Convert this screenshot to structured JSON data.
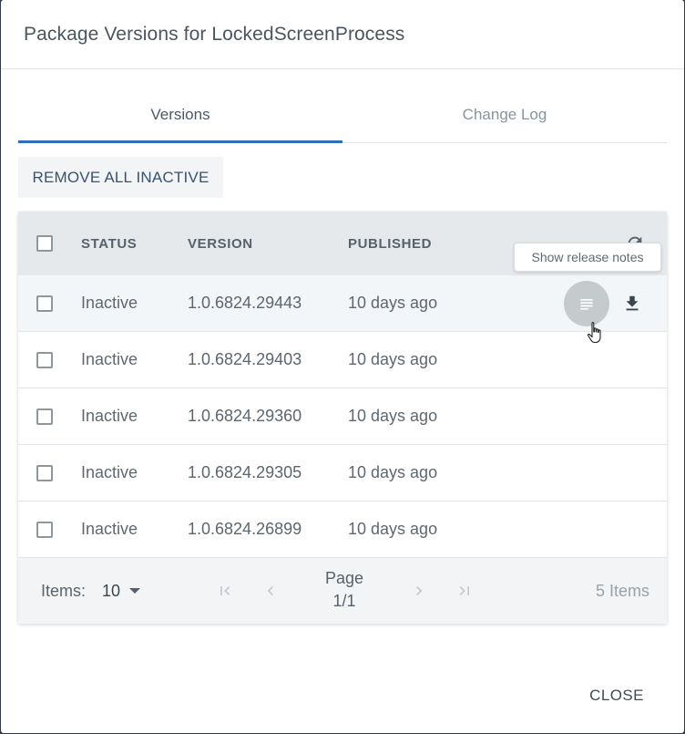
{
  "dialog": {
    "title": "Package Versions for LockedScreenProcess"
  },
  "tabs": [
    {
      "label": "Versions",
      "active": true
    },
    {
      "label": "Change Log",
      "active": false
    }
  ],
  "toolbar": {
    "remove_all_inactive_label": "REMOVE ALL INACTIVE"
  },
  "table": {
    "columns": {
      "status": "STATUS",
      "version": "VERSION",
      "published": "PUBLISHED"
    },
    "rows": [
      {
        "status": "Inactive",
        "version": "1.0.6824.29443",
        "published": "10 days ago",
        "checked": false
      },
      {
        "status": "Inactive",
        "version": "1.0.6824.29403",
        "published": "10 days ago",
        "checked": false
      },
      {
        "status": "Inactive",
        "version": "1.0.6824.29360",
        "published": "10 days ago",
        "checked": false
      },
      {
        "status": "Inactive",
        "version": "1.0.6824.29305",
        "published": "10 days ago",
        "checked": false
      },
      {
        "status": "Inactive",
        "version": "1.0.6824.26899",
        "published": "10 days ago",
        "checked": false
      }
    ],
    "hovered_row_index": 0,
    "tooltip": "Show release notes"
  },
  "pager": {
    "items_label": "Items:",
    "items_per_page": "10",
    "page_label": "Page",
    "page_value": "1/1",
    "total_items": "5 Items"
  },
  "footer": {
    "close_label": "CLOSE"
  },
  "colors": {
    "accent": "#2c71b8",
    "header_bg": "#e6e9ec",
    "pager_bg": "#f2f4f5",
    "notes_button_bg": "#c5cacd"
  },
  "icons": {
    "refresh": "refresh-icon",
    "release_notes": "notes-icon",
    "download": "download-icon",
    "first_page": "first-page-icon",
    "prev_page": "prev-page-icon",
    "next_page": "next-page-icon",
    "last_page": "last-page-icon",
    "dropdown": "chevron-down-icon"
  }
}
